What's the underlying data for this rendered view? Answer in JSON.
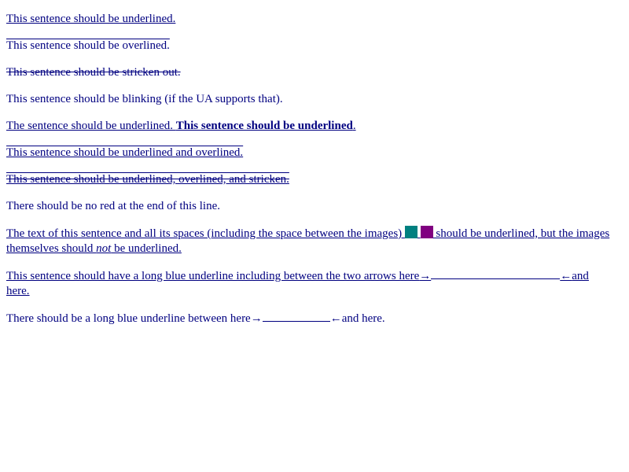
{
  "lines": {
    "underlined": "This sentence should be underlined.",
    "overlined": "This sentence should be overlined.",
    "stricken": "This sentence should be stricken out.",
    "blinking": "This sentence should be blinking (if the UA supports that).",
    "underlined_mixed_plain": "The sentence should be underlined. ",
    "underlined_mixed_bold": "This sentence should be underlined",
    "underlined_mixed_end": ".",
    "underlined_overlined": "This sentence should be underlined and overlined.",
    "underlined_overlined_stricken": "This sentence should be underlined, overlined, and stricken.",
    "no_red": "There should be no red at the end of this line.",
    "images_part1": "The text of this sentence and all its spaces (including the space between the images) ",
    "images_part2": " should be underlined, but the images themselves should ",
    "images_not": "not",
    "images_part3": " be underlined.",
    "long_part1": "This sentence should have a long blue underline including between the two arrows here",
    "long_arrow_right": "→",
    "long_arrow_left": "←",
    "long_part2": "and here.",
    "short_part1": "There should be a long blue underline between here",
    "short_arrow_right": "→",
    "short_arrow_left": "←",
    "short_part2": "and here."
  },
  "colors": {
    "text": "#000080",
    "image_1": "#008080",
    "image_2": "#800080"
  }
}
